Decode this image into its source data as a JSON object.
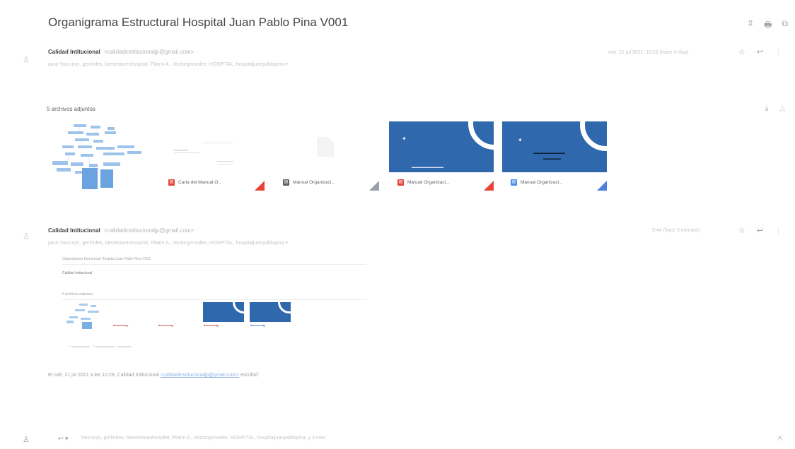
{
  "email": {
    "subject": "Organigrama Estructural Hospital Juan Pablo Pina V001",
    "toolbar_icons": [
      "expand-icon",
      "print-icon",
      "open-new-window-icon"
    ]
  },
  "message1": {
    "sender_name": "Calidad Intitucional",
    "sender_email": "<calidadinstitucionaljp@gmail.com>",
    "recipients": "para Yancurys, gerlindes, bienestareshospital, Pilarin A., doctorgonzalez, HOSPITAL, hospitaljuanpablopina ▾",
    "datetime": "mié, 21 jul 2021, 10:29 (hace 4 días)",
    "attachments_label": "5 archivos adjuntos",
    "attachments": [
      {
        "name": "",
        "type": "image"
      },
      {
        "name": "Carta del Manual O...",
        "type": "pdf"
      },
      {
        "name": "Manual Organizaci...",
        "type": "doc"
      },
      {
        "name": "Manual Organizaci...",
        "type": "pdf"
      },
      {
        "name": "Manual Organizaci...",
        "type": "word"
      }
    ]
  },
  "message2": {
    "sender_name": "Calidad Intitucional",
    "sender_email": "<calidadinstitucionaljp@gmail.com>",
    "recipients": "para Yancurys, gerlindes, bienestareshospital, Pilarin A., doctorgonzalez, HOSPITAL, hospitaljuanpablopina ▾",
    "datetime": "9:44 (hace 3 minutos)",
    "quoted_subject": "Organigrama Estructural Hospital Juan Pablo Pina V001"
  },
  "footer": {
    "quote_prefix": "El mié, 21 jul 2021 a las 10:29, Calidad Intitucional",
    "quote_email": "<calidadinstitucionaljp@gmail.com>",
    "quote_suffix": "escribió:"
  },
  "reply_bar": {
    "placeholder": "Yancurys, gerlindes, bienestareshospital, Pilarin A., doctorgonzalez, HOSPITAL, hospitaljuanpablopina, y 3 más"
  }
}
